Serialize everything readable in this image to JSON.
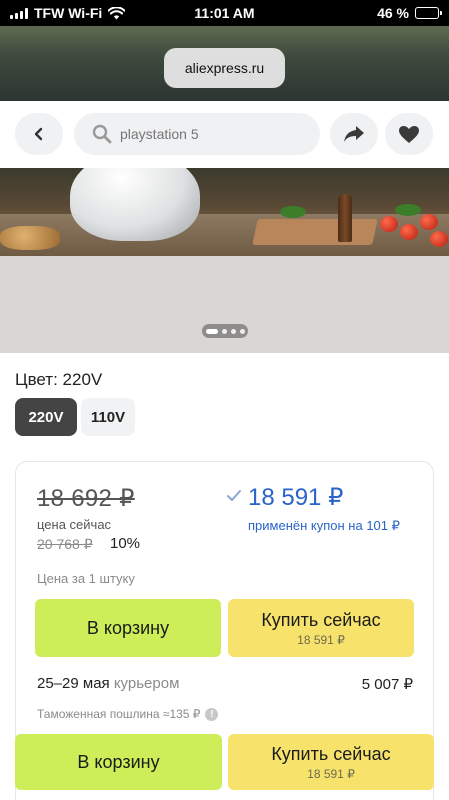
{
  "status_bar": {
    "carrier": "TFW Wi-Fi",
    "time": "11:01 AM",
    "battery_text": "46 %",
    "battery_level": 0.46
  },
  "browser": {
    "url": "aliexpress.ru"
  },
  "header": {
    "search_placeholder": "playstation 5",
    "icons": [
      "back-icon",
      "search-icon",
      "share-icon",
      "heart-icon"
    ]
  },
  "gallery": {
    "slides": 4,
    "active_slide": 1
  },
  "product": {
    "color_label": "Цвет: 220V",
    "options": [
      "220V",
      "110V"
    ],
    "selected_option": "220V"
  },
  "price": {
    "old": "18 692 ₽",
    "now_label": "цена сейчас",
    "original": "20 768 ₽",
    "discount": "10%",
    "new": "18 591 ₽",
    "coupon_note": "применён купон на 101 ₽",
    "per_unit": "Цена за 1 штуку"
  },
  "actions": {
    "cart": "В корзину",
    "buy": "Купить сейчас",
    "buy_price": "18 591 ₽"
  },
  "delivery": {
    "dates": "25–29 мая",
    "method": "курьером",
    "price": "5 007 ₽",
    "duty_note": "Таможенная пошлина ≈135 ₽"
  },
  "colors": {
    "accent_blue": "#2b64c8",
    "cart_green": "#cdee58",
    "buy_yellow": "#f7e36c"
  }
}
